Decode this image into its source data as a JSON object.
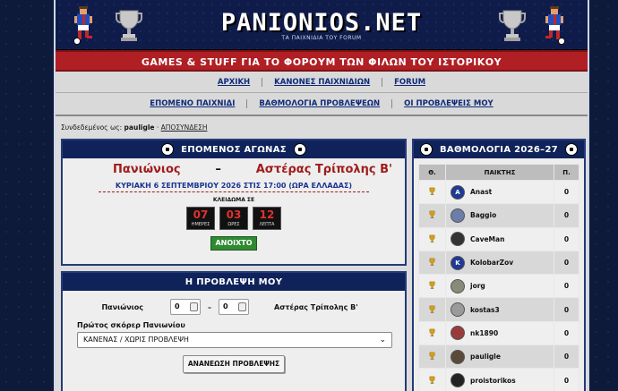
{
  "banner": {
    "title": "PANIONIOS.NET",
    "subtitle": "ΤΑ ΠΑΙΧΝΙΔΙΑ ΤΟΥ FORUM",
    "tagline": "GAMES & STUFF ΓΙΑ ΤΟ ΦΟΡΟΥΜ ΤΩΝ ΦΙΛΩΝ ΤΟΥ ΙΣΤΟΡΙΚΟΥ"
  },
  "nav_primary": [
    "ΑΡΧΙΚΗ",
    "ΚΑΝΟΝΕΣ ΠΑΙΧΝΙΔΙΩΝ",
    "FORUM"
  ],
  "nav_secondary": [
    "ΕΠΟΜΕΝΟ ΠΑΙΧΝΙΔΙ",
    "ΒΑΘΜΟΛΟΓΙΑ ΠΡΟΒΛΕΨΕΩΝ",
    "ΟΙ ΠΡΟΒΛΕΨΕΙΣ ΜΟΥ"
  ],
  "session": {
    "prefix": "Συνδεδεμένος ως:",
    "username": "pauligle",
    "logout": "ΑΠΟΣΥΝΔΕΣΗ"
  },
  "next_match": {
    "heading": "ΕΠΟΜΕΝΟΣ ΑΓΩΝΑΣ",
    "home": "Πανιώνιος",
    "separator": "–",
    "away": "Αστέρας Τρίπολης Β'",
    "kickoff": "ΚΥΡΙΑΚΗ 6 ΣΕΠΤΕΜΒΡΙΟΥ 2026 ΣΤΙΣ 17:00 (ΩΡΑ ΕΛΛΑΔΑΣ)",
    "lock_label": "ΚΛΕΙΔΩΜΑ ΣΕ",
    "countdown": [
      {
        "value": "07",
        "unit": "ΗΜΕΡΕΣ"
      },
      {
        "value": "03",
        "unit": "ΩΡΕΣ"
      },
      {
        "value": "12",
        "unit": "ΛΕΠΤΑ"
      }
    ],
    "status": "ΑΝΟΙΧΤΟ"
  },
  "prediction": {
    "heading": "Η ΠΡΟΒΛΕΨΗ ΜΟΥ",
    "home": "Πανιώνιος",
    "home_score": "0",
    "separator": "–",
    "away_score": "0",
    "away": "Αστέρας Τρίπολης Β'",
    "scorer_label": "Πρώτος σκόρερ Πανιωνίου",
    "scorer_value": "ΚΑΝΕΝΑΣ / ΧΩΡΙΣ ΠΡΟΒΛΕΨΗ",
    "submit": "ΑΝΑΝΕΩΣΗ ΠΡΟΒΛΕΨΗΣ"
  },
  "ranking": {
    "heading": "ΒΑΘΜΟΛΟΓΙΑ 2026–27",
    "columns": [
      "Θ.",
      "ΠΑΙΚΤΗΣ",
      "Π."
    ],
    "rows": [
      {
        "player": "Anast",
        "points": "0",
        "avatar": "A",
        "color": "#1f3a93"
      },
      {
        "player": "Baggio",
        "points": "0",
        "avatar": "",
        "color": "#6b7da8"
      },
      {
        "player": "CaveMan",
        "points": "0",
        "avatar": "",
        "color": "#333333"
      },
      {
        "player": "KolobarZov",
        "points": "0",
        "avatar": "K",
        "color": "#1f3a93"
      },
      {
        "player": "jorg",
        "points": "0",
        "avatar": "",
        "color": "#8a8a7a"
      },
      {
        "player": "kostas3",
        "points": "0",
        "avatar": "",
        "color": "#9a9a9a"
      },
      {
        "player": "nk1890",
        "points": "0",
        "avatar": "",
        "color": "#9a3a3a"
      },
      {
        "player": "pauligle",
        "points": "0",
        "avatar": "",
        "color": "#5a4a3a"
      },
      {
        "player": "proistorikos",
        "points": "0",
        "avatar": "",
        "color": "#222222"
      }
    ]
  },
  "colors": {
    "navy": "#10225a",
    "red": "#b01f24",
    "team_red": "#a01c1c",
    "green": "#2f8a32"
  }
}
